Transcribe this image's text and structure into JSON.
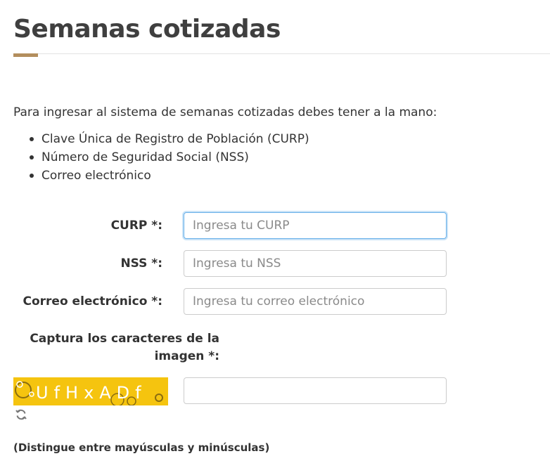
{
  "page": {
    "title": "Semanas cotizadas",
    "accent_color": "#b38e5d"
  },
  "intro": {
    "text": "Para ingresar al sistema de semanas cotizadas debes tener a la mano:",
    "items": [
      "Clave Única de Registro de Población (CURP)",
      "Número de Seguridad Social (NSS)",
      "Correo electrónico"
    ]
  },
  "form": {
    "curp": {
      "label": "CURP *:",
      "value": "",
      "placeholder": "Ingresa tu CURP"
    },
    "nss": {
      "label": "NSS *:",
      "value": "",
      "placeholder": "Ingresa tu NSS"
    },
    "email": {
      "label": "Correo electrónico *:",
      "value": "",
      "placeholder": "Ingresa tu correo electrónico"
    },
    "captcha": {
      "label_line1": "Captura los caracteres de la",
      "label_line2": "imagen *:",
      "value": "",
      "placeholder": "",
      "image_text": "UfHxADf",
      "image_background": "#f5c40f",
      "refresh_icon": "refresh-icon",
      "case_note": "(Distingue entre mayúsculas y minúsculas)"
    }
  }
}
